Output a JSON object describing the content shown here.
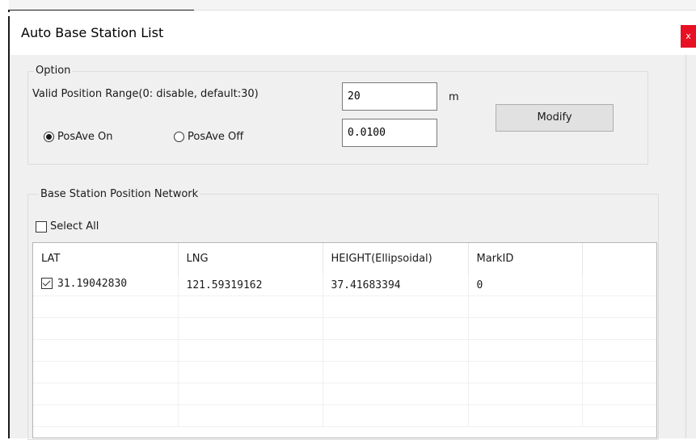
{
  "dialog": {
    "title": "Auto Base Station List",
    "close_glyph": "x"
  },
  "option_group": {
    "label": "Option",
    "range_label": "Valid Position Range(0: disable, default:30)",
    "range_value": "20",
    "unit": "m",
    "posave_on_label": "PosAve On",
    "posave_off_label": "PosAve Off",
    "posave_on_selected": true,
    "second_value": "0.0100",
    "modify_label": "Modify"
  },
  "network_group": {
    "label": "Base Station Position Network",
    "select_all_label": "Select All",
    "select_all_checked": false
  },
  "table": {
    "columns": [
      "LAT",
      "LNG",
      "HEIGHT(Ellipsoidal)",
      "MarkID"
    ],
    "rows": [
      {
        "checked": true,
        "lat": "31.19042830",
        "lng": "121.59319162",
        "height": "37.41683394",
        "markid": "0"
      }
    ]
  }
}
